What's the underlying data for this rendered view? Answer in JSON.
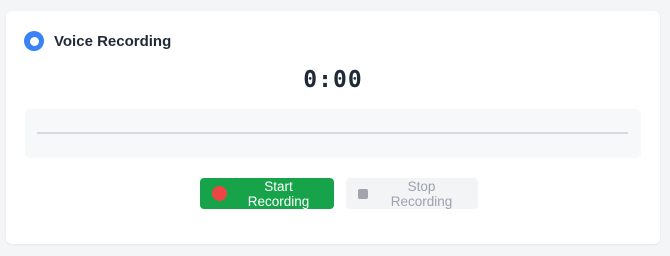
{
  "widget": {
    "title": "Voice Recording",
    "timer": "0:00"
  },
  "controls": {
    "start_label": "Start Recording",
    "stop_label": "Stop Recording",
    "stop_disabled": true
  },
  "icons": {
    "header": "recording-indicator-icon",
    "start": "record-dot-icon",
    "stop": "stop-square-icon"
  },
  "colors": {
    "accent": "#3b82f6",
    "start_button": "#16a34a",
    "record_dot": "#ef4444",
    "stop_button_bg": "#f3f4f6",
    "stop_button_text": "#9ca3af"
  }
}
